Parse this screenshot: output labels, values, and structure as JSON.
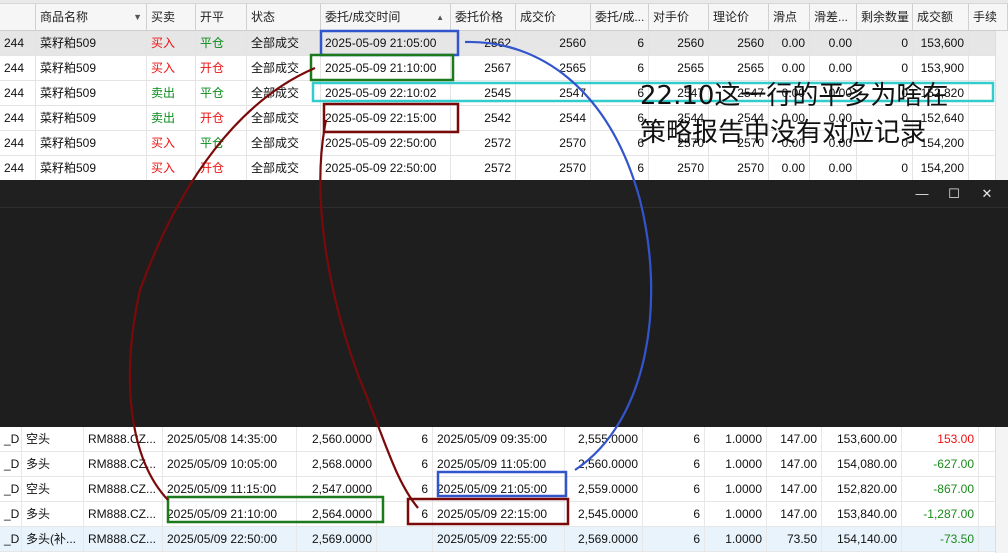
{
  "orders": {
    "columns": [
      "商品名称",
      "买卖",
      "开平",
      "状态",
      "委托/成交时间",
      "委托价格",
      "成交价",
      "委托/成...",
      "对手价",
      "理论价",
      "滑点",
      "滑差...",
      "剩余数量",
      "成交额",
      "手续"
    ],
    "rows": [
      {
        "id": "244",
        "name": "菜籽粕509",
        "side": "买入",
        "oc": "平仓",
        "status": "全部成交",
        "time": "2025-05-09 21:05:00",
        "order_price": "2562",
        "fill_price": "2560",
        "qty": "6",
        "opp": "2560",
        "theory": "2560",
        "slip": "0.00",
        "slipdiff": "0.00",
        "remain": "0",
        "amount": "153,600"
      },
      {
        "id": "244",
        "name": "菜籽粕509",
        "side": "买入",
        "oc": "开仓",
        "status": "全部成交",
        "time": "2025-05-09 21:10:00",
        "order_price": "2567",
        "fill_price": "2565",
        "qty": "6",
        "opp": "2565",
        "theory": "2565",
        "slip": "0.00",
        "slipdiff": "0.00",
        "remain": "0",
        "amount": "153,900"
      },
      {
        "id": "244",
        "name": "菜籽粕509",
        "side": "卖出",
        "oc": "平仓",
        "status": "全部成交",
        "time": "2025-05-09 22:10:02",
        "order_price": "2545",
        "fill_price": "2547",
        "qty": "6",
        "opp": "2547",
        "theory": "2547",
        "slip": "0.00",
        "slipdiff": "0.00",
        "remain": "0",
        "amount": "152,820"
      },
      {
        "id": "244",
        "name": "菜籽粕509",
        "side": "卖出",
        "oc": "开仓",
        "status": "全部成交",
        "time": "2025-05-09 22:15:00",
        "order_price": "2542",
        "fill_price": "2544",
        "qty": "6",
        "opp": "2544",
        "theory": "2544",
        "slip": "0.00",
        "slipdiff": "0.00",
        "remain": "0",
        "amount": "152,640"
      },
      {
        "id": "244",
        "name": "菜籽粕509",
        "side": "买入",
        "oc": "平仓",
        "status": "全部成交",
        "time": "2025-05-09 22:50:00",
        "order_price": "2572",
        "fill_price": "2570",
        "qty": "6",
        "opp": "2570",
        "theory": "2570",
        "slip": "0.00",
        "slipdiff": "0.00",
        "remain": "0",
        "amount": "154,200"
      },
      {
        "id": "244",
        "name": "菜籽粕509",
        "side": "买入",
        "oc": "开仓",
        "status": "全部成交",
        "time": "2025-05-09 22:50:00",
        "order_price": "2572",
        "fill_price": "2570",
        "qty": "6",
        "opp": "2570",
        "theory": "2570",
        "slip": "0.00",
        "slipdiff": "0.00",
        "remain": "0",
        "amount": "154,200"
      }
    ]
  },
  "window_controls": {
    "minimize": "—",
    "maximize": "☐",
    "close": "✕"
  },
  "report": {
    "rows": [
      {
        "code": "_D",
        "dir": "空头",
        "sym": "RM888.CZ...",
        "open_time": "2025/05/08 14:35:00",
        "open_price": "2,560.0000",
        "qty": "6",
        "close_time": "2025/05/09 09:35:00",
        "close_price": "2,555.0000",
        "lots": "6",
        "mult": "1.0000",
        "fee": "147.00",
        "amount": "153,600.00",
        "pnl": "153.00"
      },
      {
        "code": "_D",
        "dir": "多头",
        "sym": "RM888.CZ...",
        "open_time": "2025/05/09 10:05:00",
        "open_price": "2,568.0000",
        "qty": "6",
        "close_time": "2025/05/09 11:05:00",
        "close_price": "2,560.0000",
        "lots": "6",
        "mult": "1.0000",
        "fee": "147.00",
        "amount": "154,080.00",
        "pnl": "-627.00"
      },
      {
        "code": "_D",
        "dir": "空头",
        "sym": "RM888.CZ...",
        "open_time": "2025/05/09 11:15:00",
        "open_price": "2,547.0000",
        "qty": "6",
        "close_time": "2025/05/09 21:05:00",
        "close_price": "2,559.0000",
        "lots": "6",
        "mult": "1.0000",
        "fee": "147.00",
        "amount": "152,820.00",
        "pnl": "-867.00"
      },
      {
        "code": "_D",
        "dir": "多头",
        "sym": "RM888.CZ...",
        "open_time": "2025/05/09 21:10:00",
        "open_price": "2,564.0000",
        "qty": "6",
        "close_time": "2025/05/09 22:15:00",
        "close_price": "2,545.0000",
        "lots": "6",
        "mult": "1.0000",
        "fee": "147.00",
        "amount": "153,840.00",
        "pnl": "-1,287.00"
      },
      {
        "code": "_D",
        "dir": "多头(补...",
        "sym": "RM888.CZ...",
        "open_time": "2025/05/09 22:50:00",
        "open_price": "2,569.0000",
        "qty": "",
        "close_time": "2025/05/09 22:55:00",
        "close_price": "2,569.0000",
        "lots": "6",
        "mult": "1.0000",
        "fee": "73.50",
        "amount": "154,140.00",
        "pnl": "-73.50"
      }
    ]
  },
  "annotation": {
    "line1": "22.10这一行的平多为啥在",
    "line2": "策略报告中没有对应记录"
  },
  "colors": {
    "blue": "#3355cc",
    "green": "#1c7a1c",
    "cyan": "#33cccc",
    "darkred": "#7a0a0a"
  }
}
